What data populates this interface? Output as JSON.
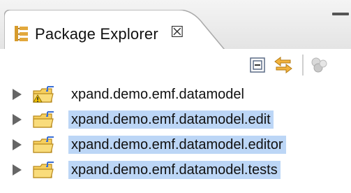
{
  "view": {
    "title": "Package Explorer",
    "close_glyph": "☒",
    "icon": "package-explorer-icon"
  },
  "toolbar": {
    "collapse_all_icon": "collapse-all-icon",
    "link_with_editor_icon": "link-with-editor-icon",
    "view_menu_icon": "view-menu-icon"
  },
  "tree": {
    "items": [
      {
        "label": "xpand.demo.emf.datamodel",
        "selected": false,
        "warning": true
      },
      {
        "label": "xpand.demo.emf.datamodel.edit",
        "selected": true,
        "warning": false
      },
      {
        "label": "xpand.demo.emf.datamodel.editor",
        "selected": true,
        "warning": false
      },
      {
        "label": "xpand.demo.emf.datamodel.tests",
        "selected": true,
        "warning": false
      }
    ]
  },
  "colors": {
    "selection": "#bcd6f6",
    "folder": "#f0c24a",
    "accent_blue": "#3a6fd6"
  }
}
